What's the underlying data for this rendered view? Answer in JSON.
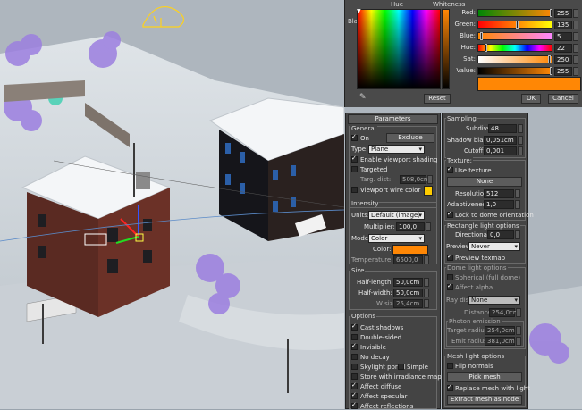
{
  "picker": {
    "hue_label": "Hue",
    "whiteness_label": "Whiteness",
    "blackness_label": "Blackness",
    "rows": [
      {
        "label": "Red:",
        "value": "255"
      },
      {
        "label": "Green:",
        "value": "135"
      },
      {
        "label": "Blue:",
        "value": "5"
      },
      {
        "label": "Hue:",
        "value": "22"
      },
      {
        "label": "Sat:",
        "value": "250"
      },
      {
        "label": "Value:",
        "value": "255"
      }
    ],
    "slider_levels": [
      1.0,
      0.53,
      0.02,
      0.09,
      0.98,
      1.0
    ],
    "swatch_color": "#ff8705",
    "reset_label": "Reset",
    "ok_label": "OK",
    "cancel_label": "Cancel"
  },
  "params": {
    "title": "Parameters",
    "general": {
      "header": "General",
      "on_label": "On",
      "exclude_label": "Exclude",
      "type_label": "Type:",
      "type_value": "Plane",
      "enable_shading_label": "Enable viewport shading",
      "targeted_label": "Targeted",
      "targ_dist_label": "Targ. dist:",
      "targ_dist_value": "508,0cm",
      "wire_color_label": "Viewport wire color",
      "wire_color": "#ffcc00"
    },
    "intensity": {
      "header": "Intensity",
      "units_label": "Units:",
      "units_value": "Default (image)",
      "multiplier_label": "Multiplier:",
      "multiplier_value": "100,0",
      "mode_label": "Mode:",
      "mode_value": "Color",
      "color_label": "Color:",
      "color_value": "#ff8705",
      "temperature_label": "Temperature:",
      "temperature_value": "6500,0"
    },
    "size": {
      "header": "Size",
      "half_length_label": "Half-length:",
      "half_length_value": "50,0cm",
      "half_width_label": "Half-width:",
      "half_width_value": "50,0cm",
      "w_size_label": "W size",
      "w_size_value": "25,4cm"
    },
    "options": {
      "header": "Options",
      "items": [
        {
          "label": "Cast shadows",
          "checked": true
        },
        {
          "label": "Double-sided",
          "checked": false
        },
        {
          "label": "Invisible",
          "checked": true
        },
        {
          "label": "No decay",
          "checked": false
        },
        {
          "label": "Skylight portal",
          "checked": false
        },
        {
          "label": "Store with irradiance map",
          "checked": false
        },
        {
          "label": "Affect diffuse",
          "checked": true
        },
        {
          "label": "Affect specular",
          "checked": true
        },
        {
          "label": "Affect reflections",
          "checked": true
        }
      ],
      "simple_label": "Simple"
    }
  },
  "sampling": {
    "header": "Sampling",
    "subdivs_label": "Subdivs:",
    "subdivs_value": "48",
    "shadow_bias_label": "Shadow bias:",
    "shadow_bias_value": "0,051cm",
    "cutoff_label": "Cutoff:",
    "cutoff_value": "0,001"
  },
  "texture": {
    "header": "Texture:",
    "use_texture_label": "Use texture",
    "none_label": "None",
    "resolution_label": "Resolution:",
    "resolution_value": "512",
    "adaptiveness_label": "Adaptiveness:",
    "adaptiveness_value": "1,0",
    "lock_label": "Lock to dome orientation"
  },
  "rect_opts": {
    "header": "Rectangle light options",
    "directional_label": "Directional:",
    "directional_value": "0,0",
    "preview_label": "Preview:",
    "preview_value": "Never",
    "preview_texmap_label": "Preview texmap"
  },
  "dome_opts": {
    "header": "Dome light options",
    "spherical_label": "Spherical (full dome)",
    "affect_alpha_label": "Affect alpha",
    "ray_dist_label": "Ray distr",
    "ray_dist_value": "None",
    "distance_label": "Distance:",
    "distance_value": "254,0cm",
    "photon_header": "Photon emission",
    "target_radius_label": "Target radius:",
    "target_radius_value": "254,0cm",
    "emit_radius_label": "Emit radius:",
    "emit_radius_value": "381,0cm"
  },
  "mesh_opts": {
    "header": "Mesh light options",
    "flip_normals_label": "Flip normals",
    "pick_mesh_label": "Pick mesh",
    "replace_mesh_label": "Replace mesh with light",
    "extract_mesh_label": "Extract mesh as node"
  }
}
